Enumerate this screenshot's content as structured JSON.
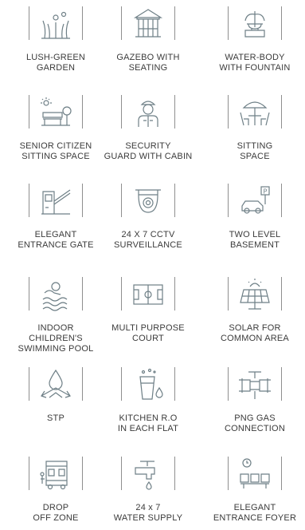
{
  "amenities": [
    {
      "label_lines": [
        "LUSH-GREEN",
        "GARDEN"
      ],
      "icon": "garden-icon"
    },
    {
      "label_lines": [
        "GAZEBO WITH",
        "SEATING"
      ],
      "icon": "gazebo-icon"
    },
    {
      "label_lines": [
        "WATER-BODY",
        "WITH FOUNTAIN"
      ],
      "icon": "fountain-icon"
    },
    {
      "label_lines": [
        "SENIOR CITIZEN",
        "SITTING SPACE"
      ],
      "icon": "bench-icon"
    },
    {
      "label_lines": [
        "SECURITY",
        "GUARD WITH CABIN"
      ],
      "icon": "security-guard-icon"
    },
    {
      "label_lines": [
        "SITTING",
        "SPACE"
      ],
      "icon": "umbrella-table-icon"
    },
    {
      "label_lines": [
        "ELEGANT",
        "ENTRANCE GATE"
      ],
      "icon": "entrance-gate-icon"
    },
    {
      "label_lines": [
        "24 X 7 CCTV",
        "SURVEILLANCE"
      ],
      "icon": "cctv-icon"
    },
    {
      "label_lines": [
        "TWO LEVEL",
        "BASEMENT"
      ],
      "icon": "parking-icon"
    },
    {
      "label_lines": [
        "INDOOR",
        "CHILDREN'S",
        "SWIMMING POOL"
      ],
      "icon": "swimmer-icon"
    },
    {
      "label_lines": [
        "MULTI PURPOSE",
        "COURT"
      ],
      "icon": "court-icon"
    },
    {
      "label_lines": [
        "SOLAR FOR",
        "COMMON AREA"
      ],
      "icon": "solar-panel-icon"
    },
    {
      "label_lines": [
        "STP"
      ],
      "icon": "water-drop-icon"
    },
    {
      "label_lines": [
        "KITCHEN R.O",
        "IN EACH FLAT"
      ],
      "icon": "water-glass-icon"
    },
    {
      "label_lines": [
        "PNG GAS",
        "CONNECTION"
      ],
      "icon": "gas-pipe-icon"
    },
    {
      "label_lines": [
        "DROP",
        "OFF ZONE"
      ],
      "icon": "school-bus-icon"
    },
    {
      "label_lines": [
        "24 x 7",
        "WATER SUPPLY"
      ],
      "icon": "tap-icon"
    },
    {
      "label_lines": [
        "ELEGANT",
        "ENTRANCE FOYER"
      ],
      "icon": "foyer-seats-icon"
    }
  ],
  "colors": {
    "line": "#8f8f8f",
    "icon": "#6e7f86",
    "text": "#3b3b3b"
  }
}
